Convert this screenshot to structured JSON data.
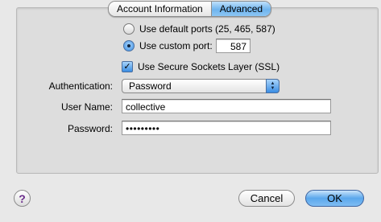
{
  "tabs": [
    {
      "label": "Account Information",
      "active": false
    },
    {
      "label": "Advanced",
      "active": true
    }
  ],
  "ports": {
    "default_label": "Use default ports (25, 465, 587)",
    "custom_label": "Use custom port:",
    "custom_value": "587",
    "selected": "custom"
  },
  "ssl": {
    "label": "Use Secure Sockets Layer (SSL)",
    "checked": true
  },
  "authentication": {
    "label": "Authentication:",
    "value": "Password"
  },
  "user_name": {
    "label": "User Name:",
    "value": "collective"
  },
  "password": {
    "label": "Password:",
    "value": "•••••••••"
  },
  "buttons": {
    "help": "?",
    "cancel": "Cancel",
    "ok": "OK"
  },
  "colors": {
    "accent": "#5aa7ec",
    "panel": "#dddddd",
    "background": "#e8e8e8"
  }
}
